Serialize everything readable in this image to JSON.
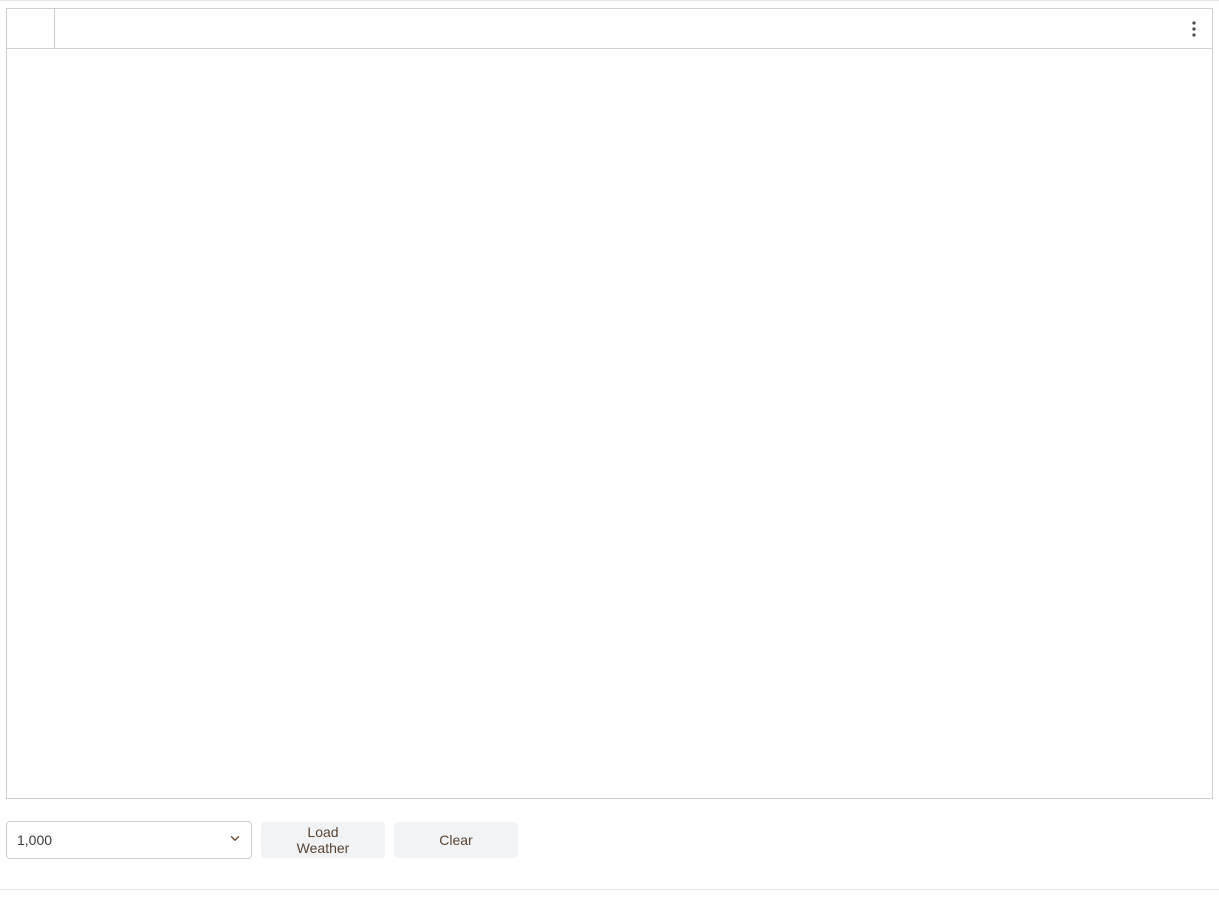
{
  "panel": {
    "header_first_label": "",
    "menu_icon": "more-vert"
  },
  "toolbar": {
    "count_select": {
      "selected": "1,000",
      "options": [
        "1,000"
      ]
    },
    "load_label": "Load Weather",
    "clear_label": "Clear"
  },
  "colors": {
    "border": "#cfcfcf",
    "button_bg": "#f1f3f5",
    "button_text": "#5a4431",
    "chevron": "#6d4a2f"
  }
}
